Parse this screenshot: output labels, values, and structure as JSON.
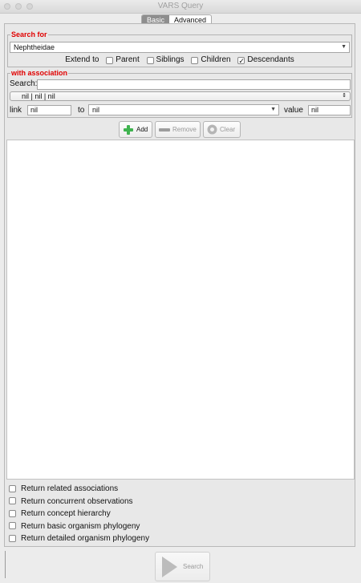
{
  "window": {
    "title": "VARS Query"
  },
  "mode_tabs": [
    {
      "label": "Basic",
      "active": true
    },
    {
      "label": "Advanced",
      "active": false
    }
  ],
  "search_for": {
    "legend": "Search for",
    "concept": "Nephtheidae",
    "extend_label": "Extend to",
    "extend_options": [
      {
        "label": "Parent",
        "checked": false
      },
      {
        "label": "Siblings",
        "checked": false
      },
      {
        "label": "Children",
        "checked": false
      },
      {
        "label": "Descendants",
        "checked": true
      }
    ]
  },
  "association": {
    "legend": "with association",
    "search_label": "Search:",
    "search_value": "",
    "selected": "nil | nil | nil",
    "link_label": "link",
    "link_value": "nil",
    "to_label": "to",
    "to_value": "nil",
    "value_label": "value",
    "value_value": "nil"
  },
  "buttons": {
    "add": "Add",
    "remove": "Remove",
    "clear": "Clear",
    "search": "Search"
  },
  "options": [
    {
      "label": "Return related associations",
      "checked": false
    },
    {
      "label": "Return concurrent observations",
      "checked": false
    },
    {
      "label": "Return concept hierarchy",
      "checked": false
    },
    {
      "label": "Return basic organism phylogeny",
      "checked": false
    },
    {
      "label": "Return detailed organism phylogeny",
      "checked": false
    }
  ],
  "colors": {
    "legend": "#e00000",
    "add_icon": "#3fb34f",
    "accent_tab": "#8e8e8e"
  },
  "icons": {
    "add": "plus-icon",
    "remove": "minus-icon",
    "clear": "clear-gear-icon",
    "search": "play-icon"
  }
}
